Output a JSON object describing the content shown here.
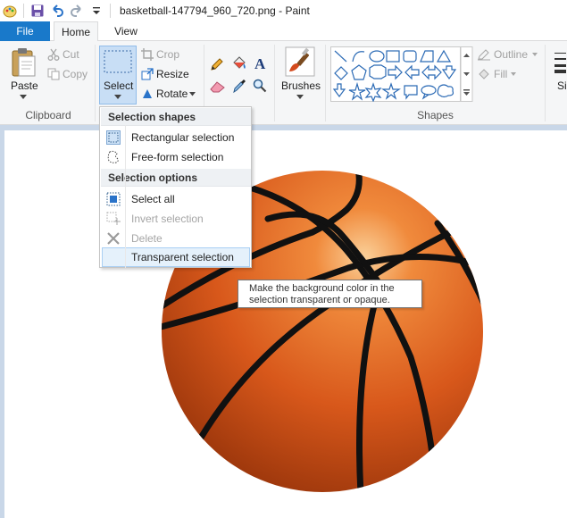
{
  "window": {
    "title": "basketball-147794_960_720.png - Paint"
  },
  "quick_access": {
    "icons": [
      "paint-app-icon",
      "save-icon",
      "undo-icon",
      "redo-icon",
      "customize-quick-access-icon"
    ]
  },
  "tabs": [
    {
      "label": "File",
      "active": false
    },
    {
      "label": "Home",
      "active": true
    },
    {
      "label": "View",
      "active": false
    }
  ],
  "ribbon": {
    "clipboard": {
      "group_label": "Clipboard",
      "paste": "Paste",
      "cut": "Cut",
      "copy": "Copy"
    },
    "image": {
      "select": "Select",
      "crop": "Crop",
      "resize": "Resize",
      "rotate": "Rotate"
    },
    "tools": {
      "icons": [
        "pencil-icon",
        "fill-bucket-icon",
        "text-icon",
        "eraser-icon",
        "color-picker-icon",
        "magnifier-icon"
      ]
    },
    "brushes": "Brushes",
    "shapes": {
      "group_label": "Shapes",
      "outline": "Outline",
      "fill": "Fill"
    },
    "size_partial": "Si"
  },
  "select_menu": {
    "section_shapes": "Selection shapes",
    "rect": {
      "label": "Rectangular selection",
      "accel": "R"
    },
    "free": {
      "label": "Free-form selection",
      "accel": "F"
    },
    "section_options": "Selection options",
    "select_all": {
      "label": "Select all",
      "accel": "a"
    },
    "invert": {
      "label": "Invert selection",
      "accel": "I",
      "disabled": true
    },
    "delete": {
      "label": "Delete",
      "accel": "D",
      "disabled": true
    },
    "transparent": {
      "label": "Transparent selection",
      "accel": "T",
      "highlighted": true
    }
  },
  "tooltip": {
    "line1": "Make the background color in the",
    "line2": "selection transparent or opaque."
  },
  "colors": {
    "file_tab": "#1979ca",
    "ribbon_bg": "#f5f6f7",
    "canvas_border": "#c9d7e8",
    "select_highlight": "#c8def5",
    "ball": "#e0641e"
  }
}
